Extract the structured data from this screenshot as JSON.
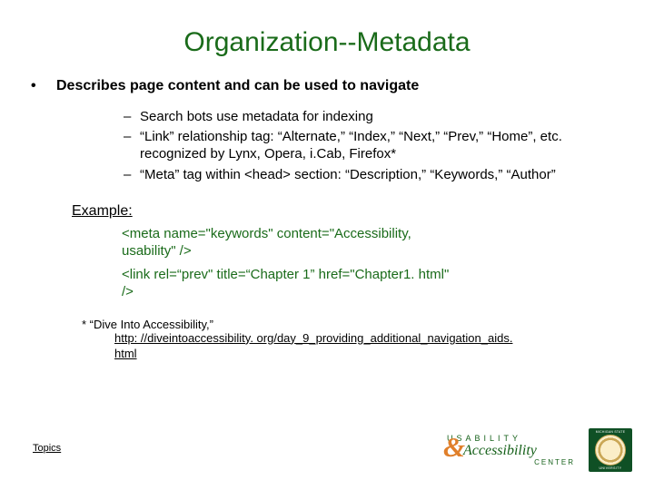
{
  "title": "Organization--Metadata",
  "bullet1": {
    "marker": "•",
    "text": "Describes page content and can be used to navigate"
  },
  "sub": {
    "a": "Search bots use metadata for indexing",
    "b": "“Link” relationship tag: “Alternate,” “Index,” “Next,” “Prev,” “Home”, etc. recognized by Lynx, Opera, i.Cab, Firefox*",
    "c": "“Meta” tag within <head> section: “Description,” “Keywords,” “Author”"
  },
  "example": {
    "label": "Example:",
    "line1": "<meta name=\"keywords\" content=\"Accessibility, usability\" />",
    "line2": "<link rel=“prev\" title=“Chapter 1” href=\"Chapter1. html\"  />"
  },
  "footnote": {
    "text": "* “Dive Into Accessibility,”",
    "url": "http: //diveintoaccessibility. org/day_9_providing_additional_navigation_aids. html"
  },
  "nav": {
    "topics": "Topics"
  },
  "footer": {
    "ua": {
      "usability": "USABILITY",
      "amp": "&",
      "access": "Accessibility",
      "center": "CENTER"
    }
  }
}
